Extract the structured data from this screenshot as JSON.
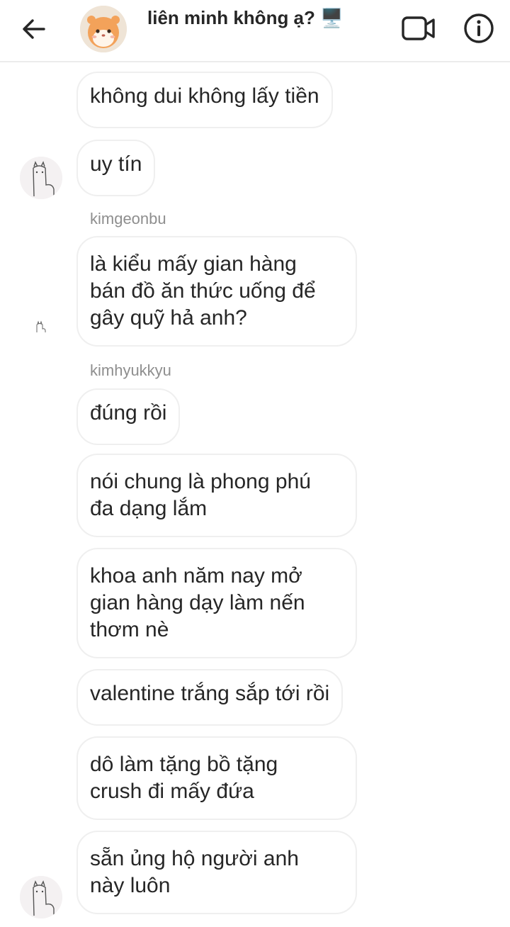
{
  "header": {
    "title": "liên minh không ạ? 🖥️",
    "back_icon": "arrow-left-icon",
    "video_icon": "video-camera-icon",
    "info_icon": "info-icon"
  },
  "messages": [
    {
      "text": "không dui không lấy tiền"
    },
    {
      "text": "uy tín"
    },
    {
      "sender": "kimgeonbu",
      "text": "là kiểu mấy gian hàng\nbán đồ ăn thức uống để\ngây quỹ hả anh?"
    },
    {
      "sender": "kimhyukkyu",
      "text": "đúng rồi"
    },
    {
      "text": "nói chung là phong phú\nđa dạng lắm"
    },
    {
      "text": "khoa anh năm nay mở\ngian hàng dạy làm nến\nthơm nè"
    },
    {
      "text": "valentine trắng sắp tới rồi"
    },
    {
      "text": "dô làm tặng bồ tặng\ncrush đi mấy đứa"
    },
    {
      "text": "sẵn ủng hộ người anh\nnày luôn"
    }
  ]
}
